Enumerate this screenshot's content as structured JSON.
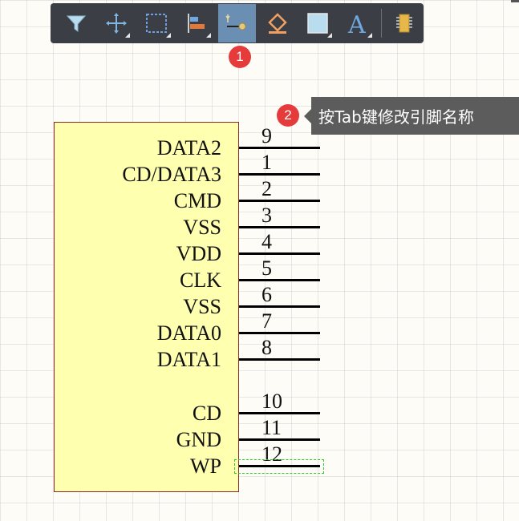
{
  "toolbar": {
    "tools": [
      {
        "name": "filter-icon",
        "active": false,
        "corner": false
      },
      {
        "name": "move-icon",
        "active": false,
        "corner": true
      },
      {
        "name": "select-rect-icon",
        "active": false,
        "corner": true
      },
      {
        "name": "align-icon",
        "active": false,
        "corner": true
      },
      {
        "name": "place-pin-icon",
        "active": true,
        "corner": false
      },
      {
        "name": "paint-fill-icon",
        "active": false,
        "corner": false
      },
      {
        "name": "rectangle-icon",
        "active": false,
        "corner": true
      },
      {
        "name": "text-icon",
        "active": false,
        "corner": true
      },
      {
        "name": "component-icon",
        "active": false,
        "corner": false
      }
    ],
    "accent_color": "#6b8fb3"
  },
  "callouts": {
    "badge1": "1",
    "badge2": "2",
    "tooltip_text": "按Tab键修改引脚名称"
  },
  "component": {
    "fill_color": "#ffffb0",
    "border_color": "#8a2a2a",
    "pins": [
      {
        "name": "DATA2",
        "number": "9"
      },
      {
        "name": "CD/DATA3",
        "number": "1"
      },
      {
        "name": "CMD",
        "number": "2"
      },
      {
        "name": "VSS",
        "number": "3"
      },
      {
        "name": "VDD",
        "number": "4"
      },
      {
        "name": "CLK",
        "number": "5"
      },
      {
        "name": "VSS",
        "number": "6"
      },
      {
        "name": "DATA0",
        "number": "7"
      },
      {
        "name": "DATA1",
        "number": "8"
      },
      {
        "name": "CD",
        "number": "10"
      },
      {
        "name": "GND",
        "number": "11"
      },
      {
        "name": "WP",
        "number": "12"
      }
    ]
  }
}
